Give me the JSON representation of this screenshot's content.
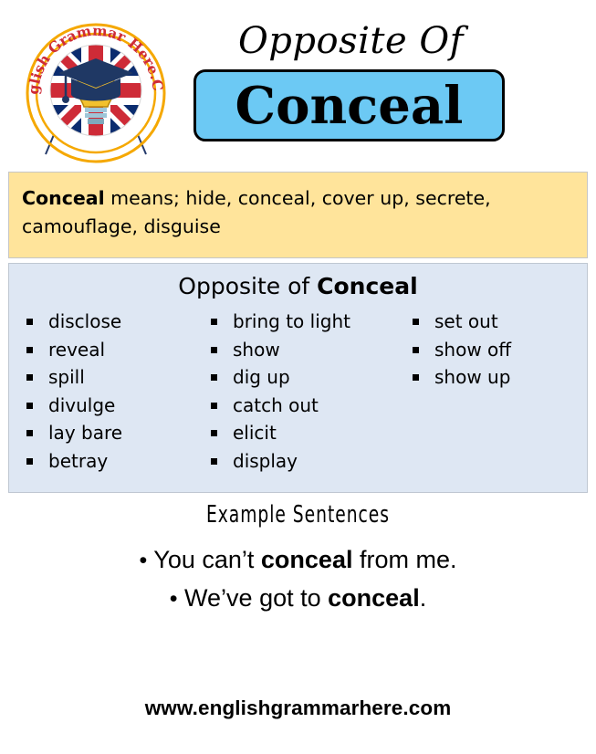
{
  "header": {
    "logo": {
      "name": "english-grammar-here-logo",
      "arc_text": "English Grammar Here.Com",
      "colors": {
        "ring": "#F5A800",
        "flag_red": "#CE2B37",
        "flag_blue": "#0B2C6F",
        "cap": "#1F3864",
        "bulb": "#F2C12E"
      }
    },
    "title_top": "Opposite Of",
    "word": "Conceal",
    "word_box_color": "#6CC9F4"
  },
  "means": {
    "term": "Conceal",
    "lead": " means; ",
    "definitions": "hide, conceal, cover up, secrete, camouflage, disguise",
    "box_color": "#FFE49B"
  },
  "opposites": {
    "heading_prefix": "Opposite of ",
    "heading_term": "Conceal",
    "box_color": "#DEE7F3",
    "columns": [
      [
        "disclose",
        "reveal",
        "spill",
        "divulge",
        "lay bare",
        "betray"
      ],
      [
        "bring to light",
        "show",
        "dig up",
        "catch out",
        "elicit",
        "display"
      ],
      [
        "set out",
        "show off",
        "show up"
      ]
    ]
  },
  "examples": {
    "heading": "Example Sentences",
    "sentences": [
      {
        "before": "You can’t ",
        "bold": "conceal",
        "after": " from me."
      },
      {
        "before": "We’ve got to ",
        "bold": "conceal",
        "after": "."
      }
    ]
  },
  "footer": {
    "url": "www.englishgrammarhere.com"
  }
}
